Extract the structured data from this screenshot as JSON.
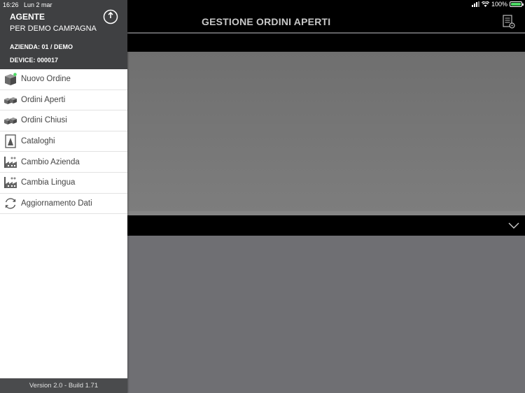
{
  "status_bar": {
    "time": "16:26",
    "date": "Lun 2 mar",
    "battery": "100%"
  },
  "main": {
    "title": "GESTIONE ORDINI APERTI"
  },
  "sidebar": {
    "agent_title": "AGENTE",
    "agent_name": "PER DEMO CAMPAGNA",
    "azienda": "AZIENDA: 01 / DEMO",
    "device": "DEVICE: 000017",
    "items": [
      {
        "label": "Nuovo Ordine",
        "icon": "box-icon"
      },
      {
        "label": "Ordini Aperti",
        "icon": "boxes-icon"
      },
      {
        "label": "Ordini Chiusi",
        "icon": "boxes-icon"
      },
      {
        "label": "Cataloghi",
        "icon": "catalog-icon"
      },
      {
        "label": "Cambio Azienda",
        "icon": "factory-icon"
      },
      {
        "label": "Cambia Lingua",
        "icon": "factory-icon"
      },
      {
        "label": "Aggiornamento Dati",
        "icon": "refresh-icon"
      }
    ],
    "version": "Version 2.0 - Build 1.71"
  },
  "colors": {
    "sidebar_header": "#3f4042",
    "header_bg": "#000000",
    "panel_gray": "#6f6f73",
    "accent_green": "#4cd964"
  }
}
